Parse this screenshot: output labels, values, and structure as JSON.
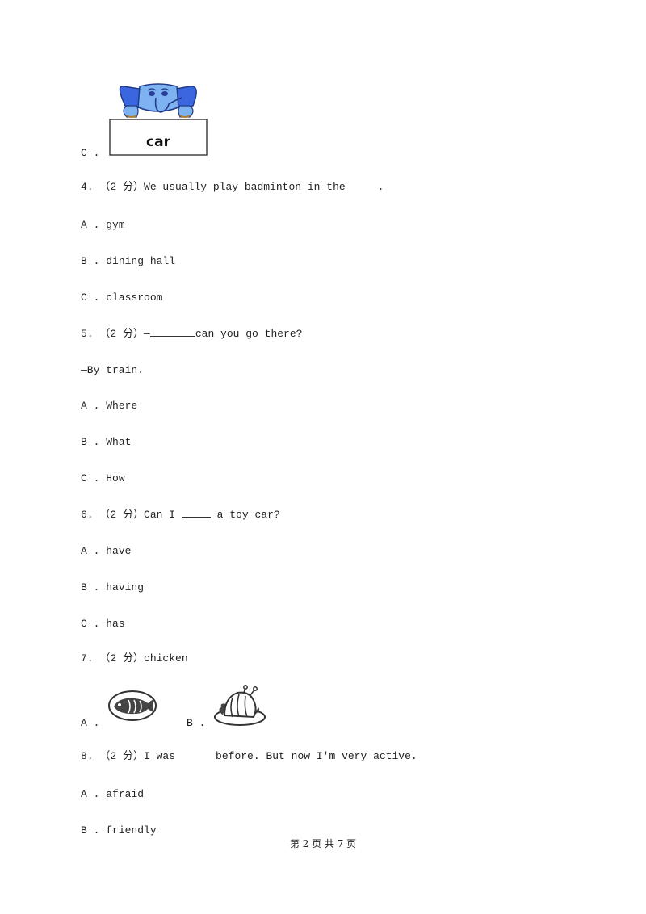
{
  "q3_option_c": {
    "label": "C .",
    "image_word": "car",
    "image_icon": "elephant-holding-sign-icon"
  },
  "questions": [
    {
      "number": "4.",
      "points": "（2 分）",
      "text": "We usually play badminton in the",
      "after_blank": ".",
      "options": [
        {
          "label": "A .",
          "text": "gym"
        },
        {
          "label": "B .",
          "text": "dining hall"
        },
        {
          "label": "C .",
          "text": "classroom"
        }
      ]
    },
    {
      "number": "5.",
      "points": "（2 分）",
      "prefix": "—",
      "text": "can you go there?",
      "answer_line": "—By train.",
      "options": [
        {
          "label": "A .",
          "text": "Where"
        },
        {
          "label": "B .",
          "text": "What"
        },
        {
          "label": "C .",
          "text": "How"
        }
      ]
    },
    {
      "number": "6.",
      "points": "（2 分）",
      "text_before": "Can I",
      "text_after": "a toy car?",
      "options": [
        {
          "label": "A .",
          "text": "have"
        },
        {
          "label": "B .",
          "text": "having"
        },
        {
          "label": "C .",
          "text": "has"
        }
      ]
    },
    {
      "number": "7.",
      "points": "（2 分）",
      "text": "chicken",
      "options": [
        {
          "label": "A .",
          "icon": "fish-on-plate-icon"
        },
        {
          "label": "B .",
          "icon": "roast-chicken-icon"
        }
      ]
    },
    {
      "number": "8.",
      "points": "（2 分）",
      "text_before": "I was",
      "text_after": "before. But now I'm very active.",
      "options": [
        {
          "label": "A .",
          "text": "afraid"
        },
        {
          "label": "B .",
          "text": "friendly"
        }
      ]
    }
  ],
  "footer": {
    "page_text": "第 2 页 共 7 页"
  }
}
